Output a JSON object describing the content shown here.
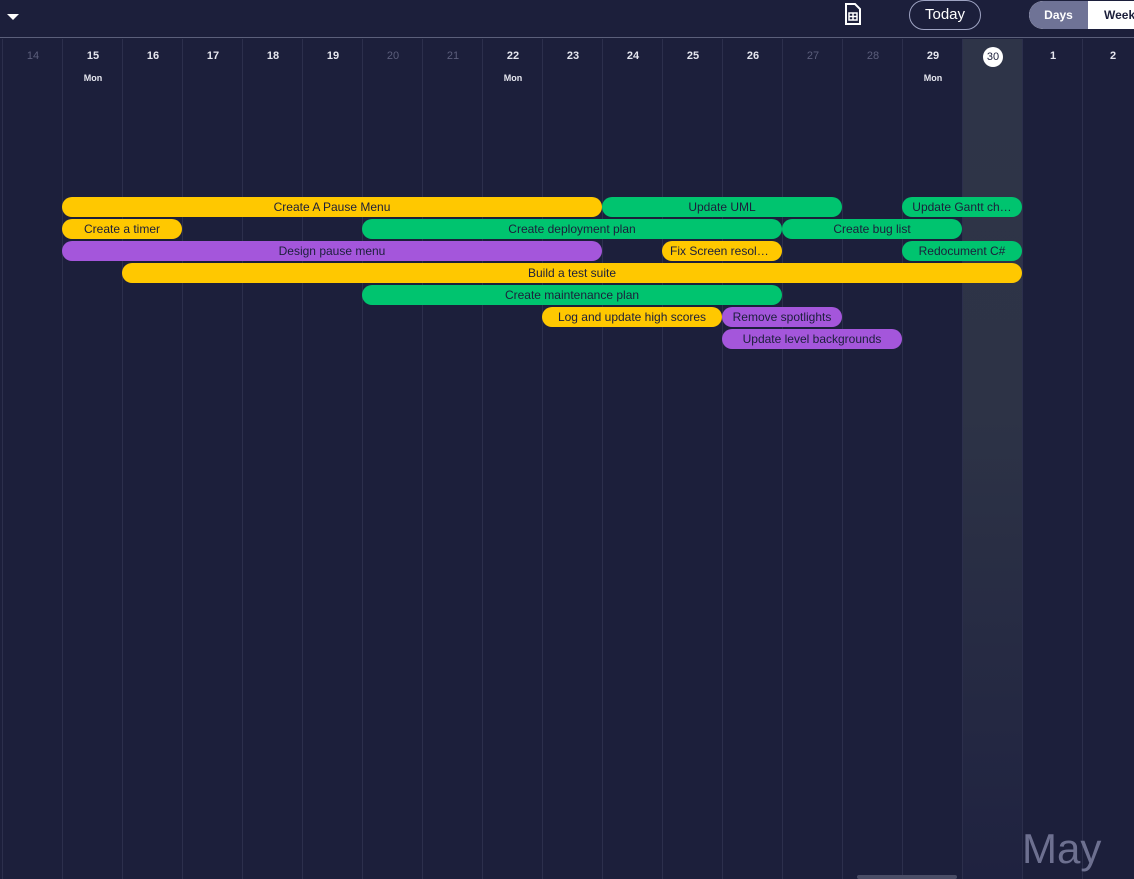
{
  "toolbar": {
    "today_label": "Today",
    "view_options": [
      "Days",
      "Weeks"
    ],
    "selected_view": "Days",
    "caret_icon": "caret-down-icon",
    "export_icon": "spreadsheet-export-icon"
  },
  "calendar": {
    "days": [
      {
        "num": "14",
        "weekend": true
      },
      {
        "num": "15",
        "sub": "Mon"
      },
      {
        "num": "16"
      },
      {
        "num": "17"
      },
      {
        "num": "18"
      },
      {
        "num": "19"
      },
      {
        "num": "20",
        "weekend": true
      },
      {
        "num": "21",
        "weekend": true
      },
      {
        "num": "22",
        "sub": "Mon"
      },
      {
        "num": "23"
      },
      {
        "num": "24"
      },
      {
        "num": "25"
      },
      {
        "num": "26"
      },
      {
        "num": "27",
        "weekend": true
      },
      {
        "num": "28",
        "weekend": true
      },
      {
        "num": "29",
        "sub": "Mon"
      },
      {
        "num": "30",
        "today": true
      },
      {
        "num": "1"
      },
      {
        "num": "2"
      }
    ],
    "month_label": "May"
  },
  "colors": {
    "yellow": "#ffc800",
    "green": "#00c46f",
    "purple": "#a456db",
    "background": "#1c1f3b"
  },
  "tasks": [
    {
      "label": "Create A Pause Menu",
      "start": "15",
      "end": "23",
      "row": 0,
      "color": "yellow"
    },
    {
      "label": "Update UML",
      "start": "24",
      "end": "27",
      "row": 0,
      "color": "green"
    },
    {
      "label": "Update Gantt ch…",
      "start": "29",
      "end": "30",
      "row": 0,
      "color": "green"
    },
    {
      "label": "Create a timer",
      "start": "15",
      "end": "16",
      "row": 1,
      "color": "yellow"
    },
    {
      "label": "Create deployment plan",
      "start": "20",
      "end": "26",
      "row": 1,
      "color": "green"
    },
    {
      "label": "Create bug list",
      "start": "27",
      "end": "29",
      "row": 1,
      "color": "green"
    },
    {
      "label": "Design pause menu",
      "start": "15",
      "end": "23",
      "row": 2,
      "color": "purple"
    },
    {
      "label": "Fix Screen resolu…",
      "start": "25",
      "end": "26",
      "row": 2,
      "color": "yellow"
    },
    {
      "label": "Redocument C#",
      "start": "29",
      "end": "30",
      "row": 2,
      "color": "green"
    },
    {
      "label": "Build a test suite",
      "start": "16",
      "end": "30",
      "row": 3,
      "color": "yellow"
    },
    {
      "label": "Create maintenance plan",
      "start": "20",
      "end": "26",
      "row": 4,
      "color": "green"
    },
    {
      "label": "Log and update high scores",
      "start": "23",
      "end": "25",
      "row": 5,
      "color": "yellow"
    },
    {
      "label": "Remove spotlights",
      "start": "26",
      "end": "27",
      "row": 5,
      "color": "purple"
    },
    {
      "label": "Update level backgrounds",
      "start": "26",
      "end": "28",
      "row": 6,
      "color": "purple"
    }
  ]
}
